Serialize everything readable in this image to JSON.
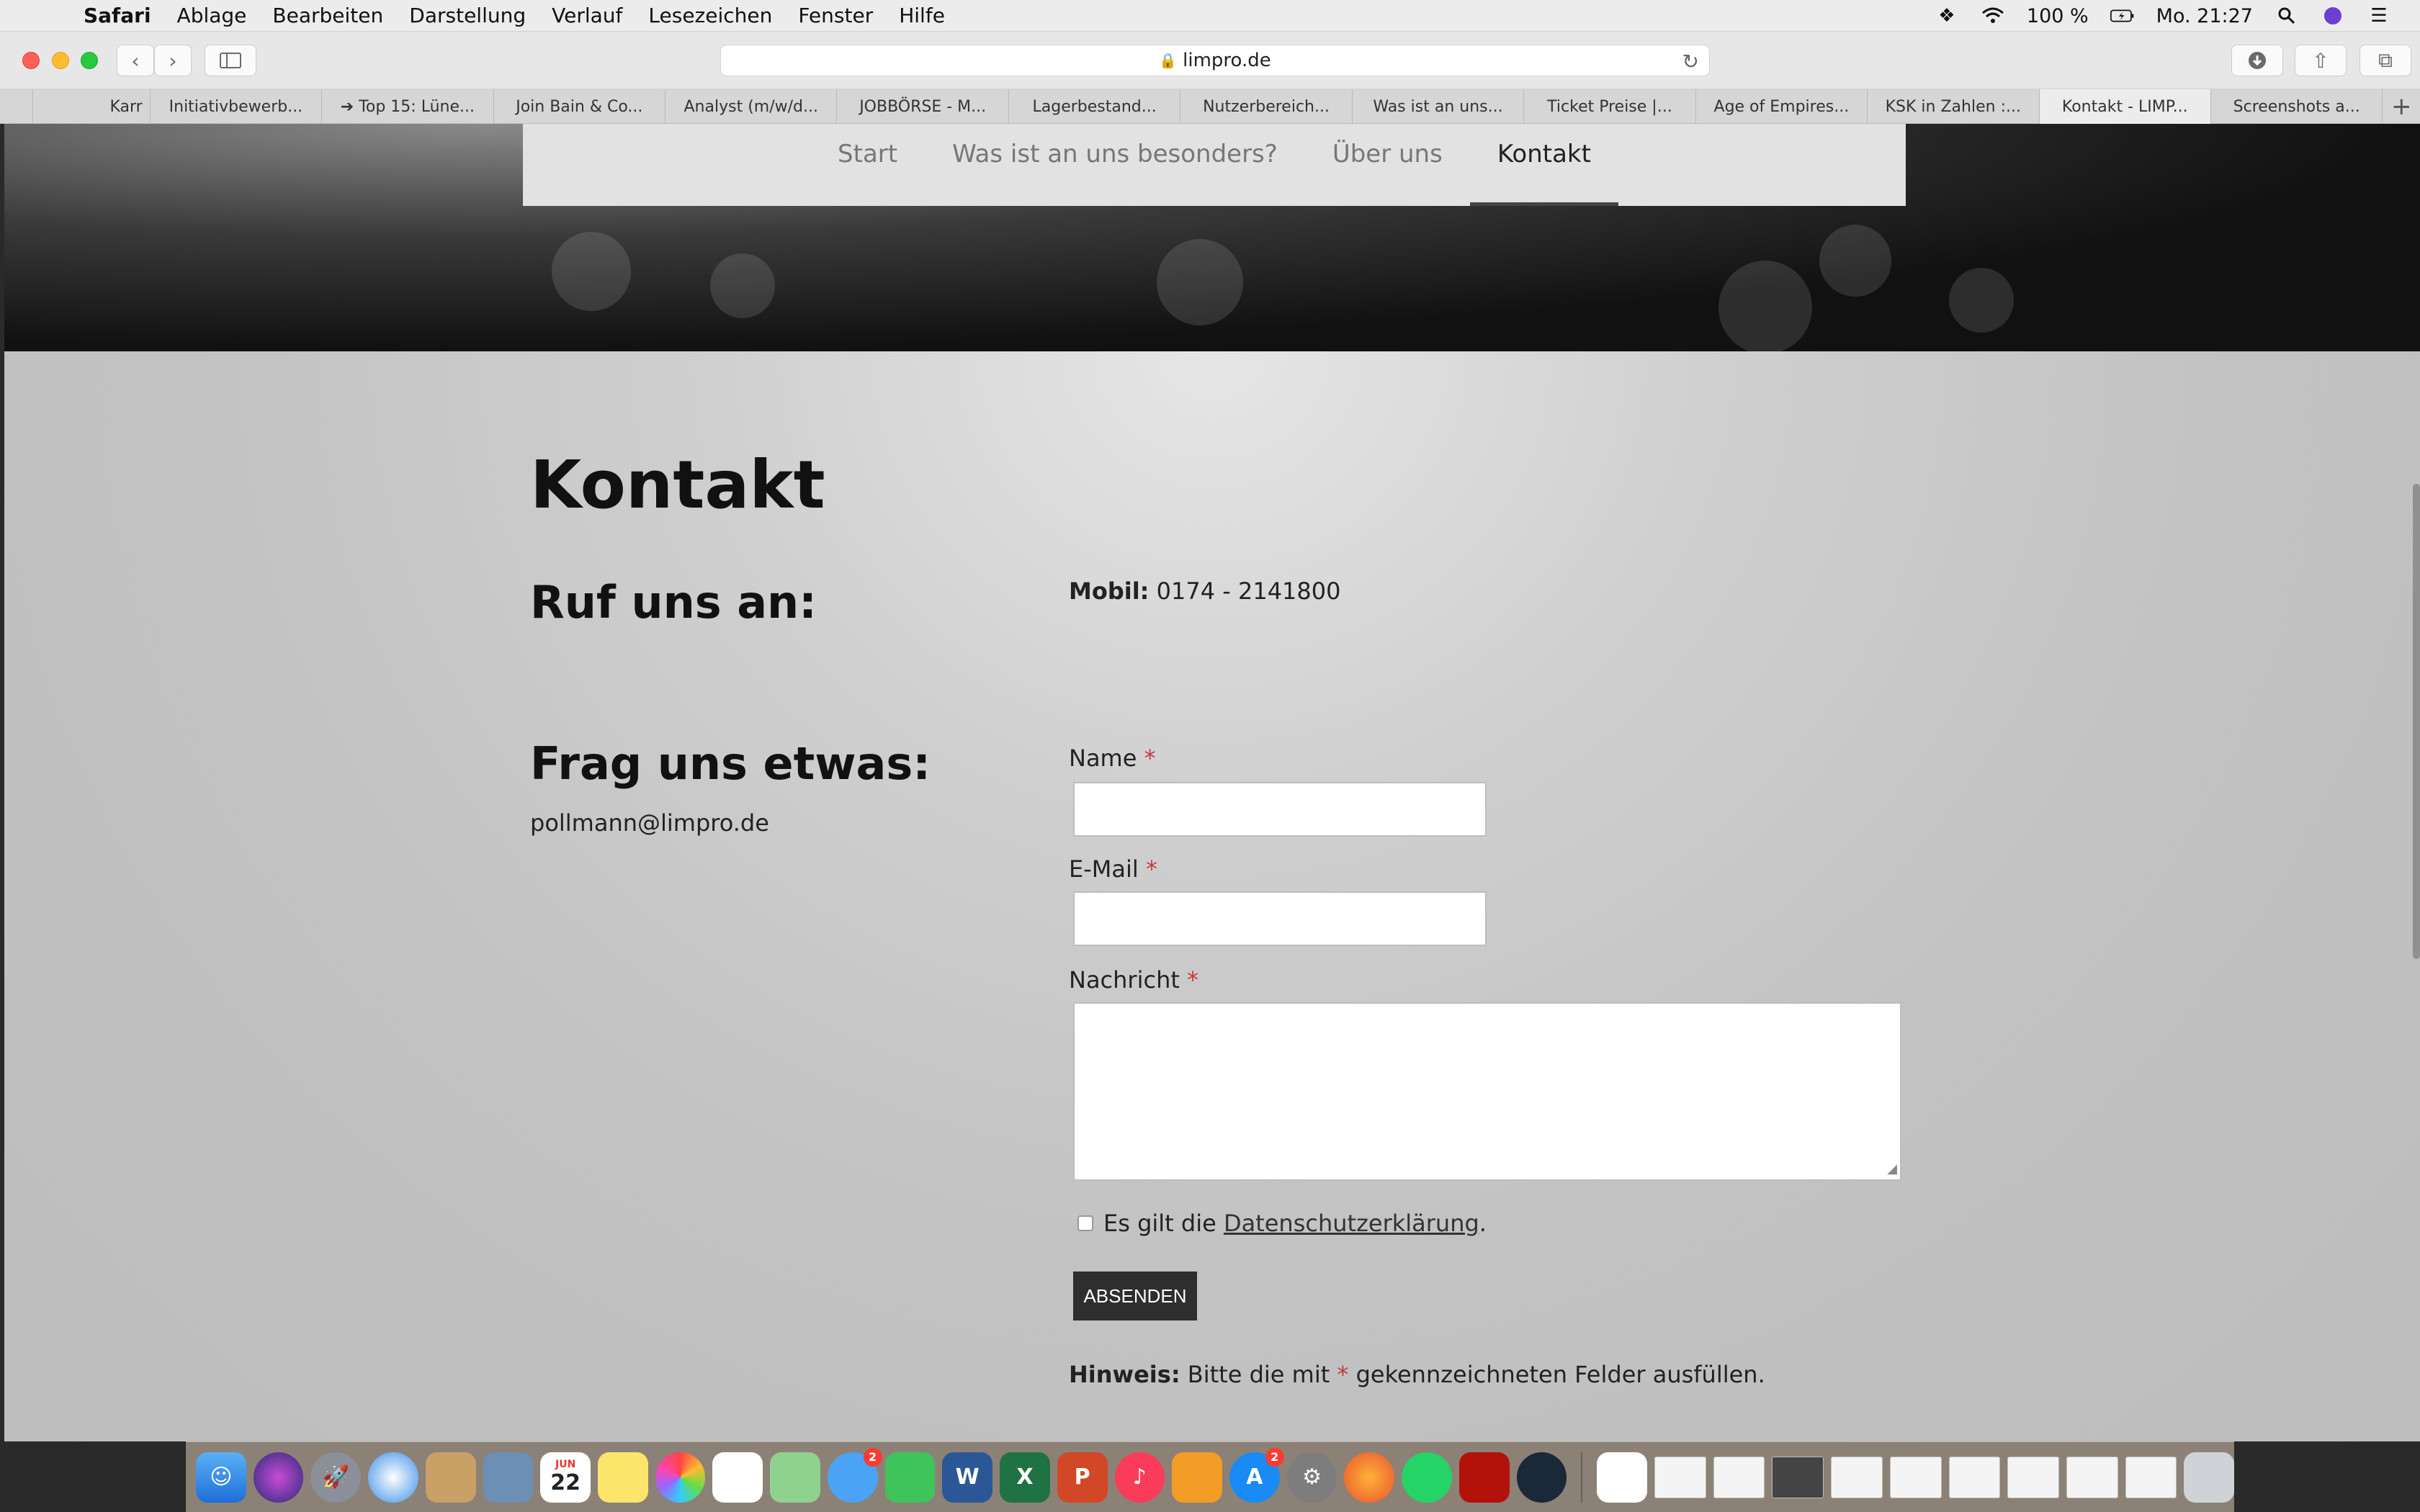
{
  "menubar": {
    "app": "Safari",
    "items": [
      "Ablage",
      "Bearbeiten",
      "Darstellung",
      "Verlauf",
      "Lesezeichen",
      "Fenster",
      "Hilfe"
    ],
    "battery": "100 %",
    "clock": "Mo. 21:27"
  },
  "browser": {
    "url": "limpro.de",
    "tabs": [
      "",
      "Karr",
      "Initiativbewerb...",
      "➔ Top 15: Lüne...",
      "Join Bain & Co...",
      "Analyst (m/w/d...",
      "JOBBÖRSE - M...",
      "Lagerbestand...",
      "Nutzerbereich...",
      "Was ist an uns...",
      "Ticket Preise |...",
      "Age of Empires...",
      "KSK in Zahlen :...",
      "Kontakt - LIMP...",
      "Screenshots a..."
    ],
    "active_tab": "Kontakt - LIMP..."
  },
  "nav": {
    "items": [
      "Start",
      "Was ist an uns besonders?",
      "Über uns",
      "Kontakt"
    ],
    "active": "Kontakt"
  },
  "content": {
    "title": "Kontakt",
    "call_heading": "Ruf uns an:",
    "mobile_label": "Mobil:",
    "mobile_number": "0174 - 2141800",
    "ask_heading": "Frag uns etwas:",
    "email": "pollmann@limpro.de"
  },
  "form": {
    "name_label": "Name",
    "email_label": "E-Mail",
    "message_label": "Nachricht",
    "required_mark": "*",
    "consent_text": "Es gilt die",
    "consent_link": "Datenschutzerklärung",
    "consent_end": ".",
    "submit": "ABSENDEN",
    "hint_label": "Hinweis:",
    "hint_text_1": "Bitte die mit",
    "hint_text_2": "gekennzeichneten Felder ausfüllen."
  },
  "dock": {
    "calendar_month": "JUN",
    "calendar_day": "22",
    "messages_badge": "2",
    "appstore_badge": "2"
  }
}
